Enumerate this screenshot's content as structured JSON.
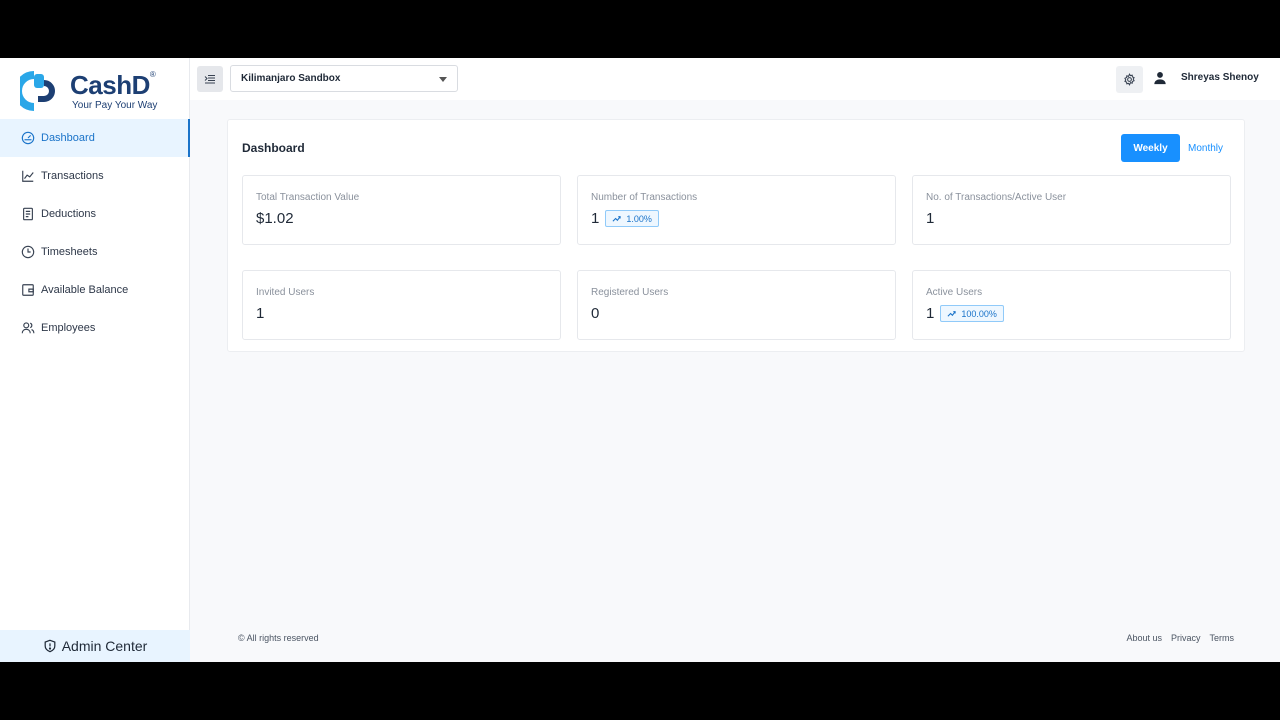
{
  "brand": {
    "name": "CashD",
    "registered": "®",
    "tagline": "Your Pay Your Way",
    "primary": "#1890ff",
    "logo_color": "#1d3f73"
  },
  "sidebar": {
    "items": [
      {
        "label": "Dashboard",
        "icon": "dashboard-gauge-icon",
        "active": true
      },
      {
        "label": "Transactions",
        "icon": "line-chart-icon",
        "active": false
      },
      {
        "label": "Deductions",
        "icon": "document-icon",
        "active": false
      },
      {
        "label": "Timesheets",
        "icon": "clock-icon",
        "active": false
      },
      {
        "label": "Available Balance",
        "icon": "wallet-icon",
        "active": false
      },
      {
        "label": "Employees",
        "icon": "users-icon",
        "active": false
      }
    ],
    "admin_center": "Admin Center"
  },
  "topbar": {
    "org_selected": "Kilimanjaro Sandbox",
    "user_name": "Shreyas Shenoy"
  },
  "dashboard": {
    "title": "Dashboard",
    "period_weekly": "Weekly",
    "period_monthly": "Monthly",
    "stats": [
      {
        "label": "Total Transaction Value",
        "value": "$1.02",
        "badge": ""
      },
      {
        "label": "Number of Transactions",
        "value": "1",
        "badge": "1.00%"
      },
      {
        "label": "No. of Transactions/Active User",
        "value": "1",
        "badge": ""
      },
      {
        "label": "Invited Users",
        "value": "1",
        "badge": ""
      },
      {
        "label": "Registered Users",
        "value": "0",
        "badge": ""
      },
      {
        "label": "Active Users",
        "value": "1",
        "badge": "100.00%"
      }
    ]
  },
  "footer": {
    "copyright": "© All rights reserved",
    "links": [
      "About us",
      "Privacy",
      "Terms"
    ]
  }
}
